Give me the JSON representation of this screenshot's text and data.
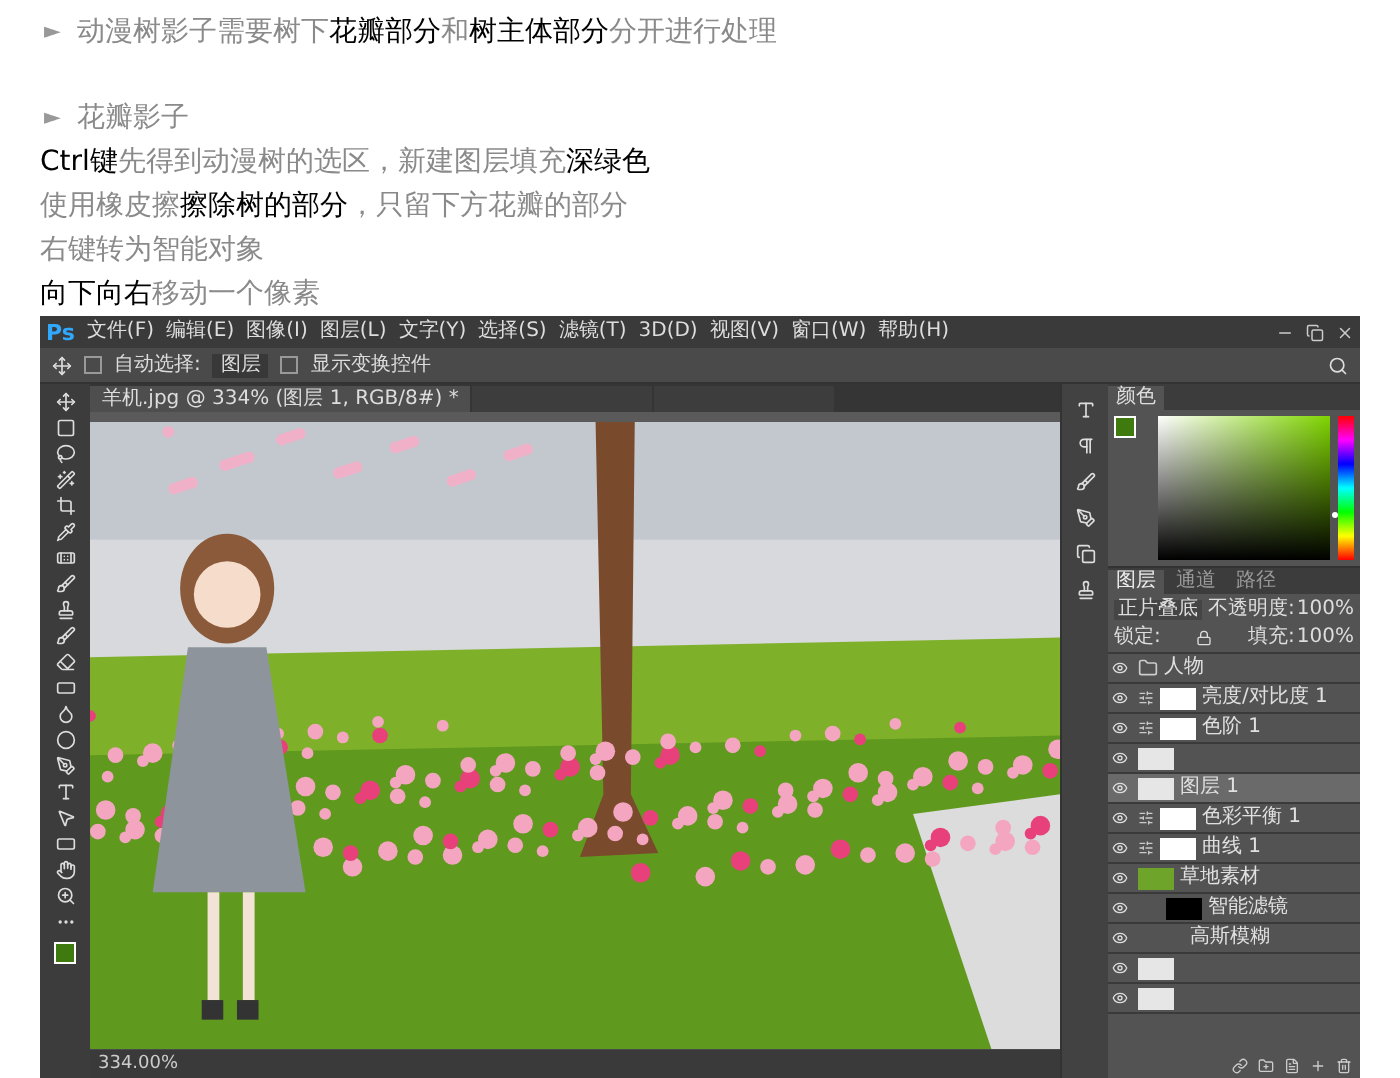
{
  "article": {
    "sections": [
      {
        "marker": "►",
        "heading": "动漫树影子需要树下**花瓣部分**和**树主体部分**分开进行处理"
      },
      {
        "marker": "►",
        "heading": "花瓣影子",
        "lines": [
          "**Ctrl键**先得到动漫树的选区，新建图层填充**深绿色**",
          "使用橡皮擦**擦除树的部分**，只留下方花瓣的部分",
          "右键转为智能对象",
          "**向下向右**移动一个像素"
        ]
      }
    ]
  },
  "photoshop": {
    "logo": "Ps",
    "menu": [
      "文件(F)",
      "编辑(E)",
      "图像(I)",
      "图层(L)",
      "文字(Y)",
      "选择(S)",
      "滤镜(T)",
      "3D(D)",
      "视图(V)",
      "窗口(W)",
      "帮助(H)"
    ],
    "options": {
      "auto_select_label": "自动选择:",
      "auto_select_checked": false,
      "auto_select_value": "图层",
      "show_transform_label": "显示变换控件",
      "show_transform_checked": false
    },
    "doc_tabs": [
      {
        "label": "羊机.jpg @ 334% (图层 1, RGB/8#) *",
        "selected": true
      },
      {
        "selected": false
      },
      {
        "selected": false
      }
    ],
    "color_panel": {
      "tab": "颜色",
      "hue": {
        "level": 0.3
      }
    },
    "layers_panel": {
      "tabs": [
        {
          "label": "图层",
          "selected": true
        },
        {
          "label": "通道",
          "selected": false
        },
        {
          "label": "路径",
          "selected": false
        }
      ],
      "blend_mode": "正片叠底",
      "opacity_label": "不透明度:",
      "opacity": "100%",
      "lock_label": "锁定:",
      "fill_label": "填充:",
      "fill": "100%",
      "layers": [
        {
          "kind": "group",
          "name": "人物",
          "visible": true,
          "selected": false
        },
        {
          "kind": "adjustment",
          "name": "亮度/对比度 1",
          "visible": true,
          "selected": false
        },
        {
          "kind": "adjustment",
          "name": "色阶 1",
          "visible": true,
          "selected": false
        },
        {
          "kind": "pixel",
          "visible": true,
          "selected": false
        },
        {
          "kind": "pixel",
          "name": "图层 1",
          "visible": true,
          "selected": true
        },
        {
          "kind": "adjustment",
          "name": "色彩平衡 1",
          "visible": true,
          "selected": false
        },
        {
          "kind": "adjustment",
          "name": "曲线 1",
          "visible": true,
          "selected": false
        },
        {
          "kind": "smart",
          "name": "草地素材",
          "visible": true,
          "selected": false
        },
        {
          "kind": "filter_mask",
          "name": "智能滤镜",
          "visible": true,
          "selected": false
        },
        {
          "kind": "filter",
          "name": "高斯模糊",
          "visible": true,
          "selected": false
        },
        {
          "kind": "pixel",
          "visible": true,
          "selected": false
        },
        {
          "kind": "pixel",
          "visible": true,
          "selected": false
        }
      ]
    },
    "status": "334.00%"
  }
}
